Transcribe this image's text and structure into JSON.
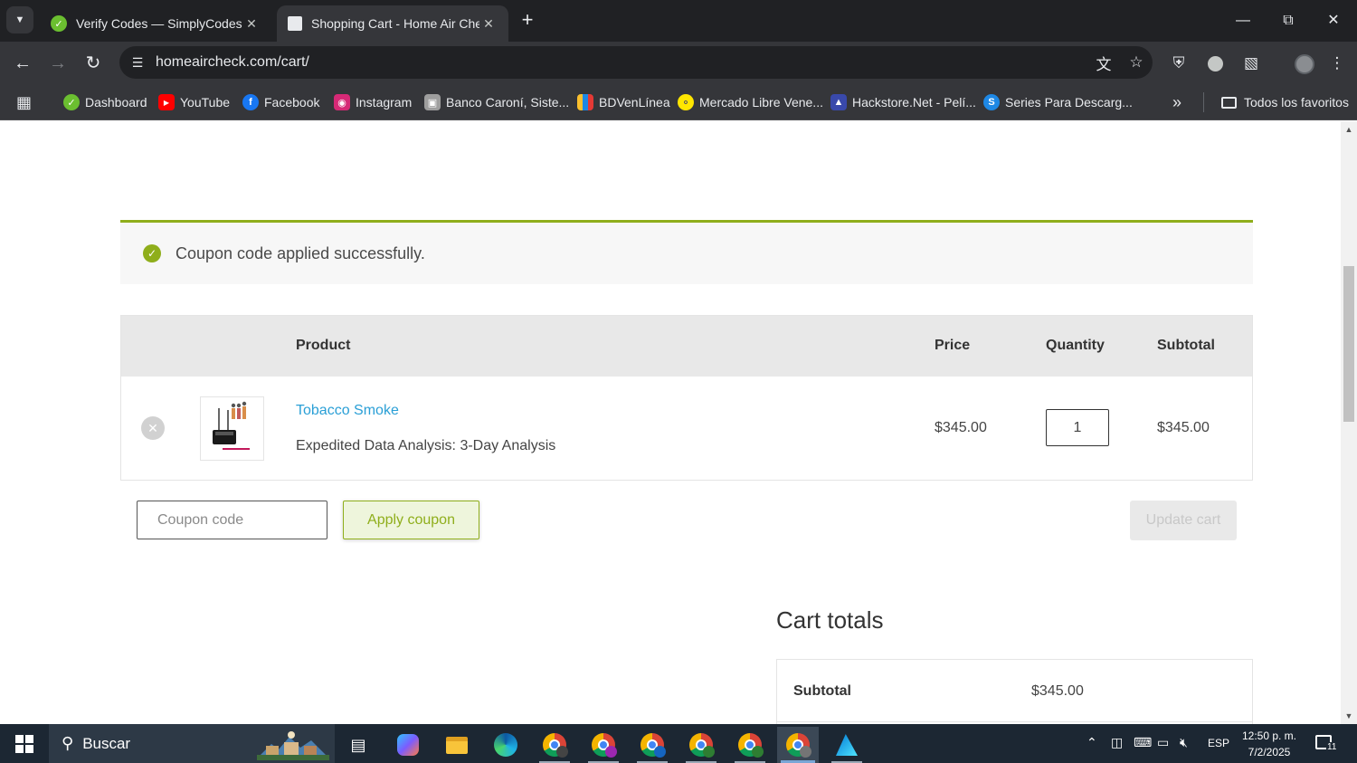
{
  "browser": {
    "tabs": [
      {
        "title": "Verify Codes — SimplyCodes",
        "active": false
      },
      {
        "title": "Shopping Cart - Home Air Chec",
        "active": true
      }
    ],
    "url": "homeaircheck.com/cart/",
    "bookmarks": [
      {
        "label": "Dashboard",
        "icon": "simplycodes-icon",
        "color": "#6bbf30"
      },
      {
        "label": "YouTube",
        "icon": "youtube-icon",
        "color": "#ff0000"
      },
      {
        "label": "Facebook",
        "icon": "facebook-icon",
        "color": "#1877f2"
      },
      {
        "label": "Instagram",
        "icon": "instagram-icon",
        "color": "#d62976"
      },
      {
        "label": "Banco Caroní, Siste...",
        "icon": "bank-icon",
        "color": "#9e9e9e"
      },
      {
        "label": "BDVenLínea",
        "icon": "bdv-icon",
        "color": "#e53935"
      },
      {
        "label": "Mercado Libre Vene...",
        "icon": "mercadolibre-icon",
        "color": "#ffe600"
      },
      {
        "label": "Hackstore.Net - Pelí...",
        "icon": "hackstore-icon",
        "color": "#3949ab"
      },
      {
        "label": "Series Para Descarg...",
        "icon": "series-icon",
        "color": "#1e88e5"
      }
    ],
    "all_bookmarks_label": "Todos los favoritos"
  },
  "notice": {
    "message": "Coupon code applied successfully.",
    "color": "#8fae1b"
  },
  "cart": {
    "headers": {
      "product": "Product",
      "price": "Price",
      "quantity": "Quantity",
      "subtotal": "Subtotal"
    },
    "items": [
      {
        "name": "Tobacco Smoke",
        "meta": "Expedited Data Analysis: 3-Day Analysis",
        "price": "$345.00",
        "quantity": "1",
        "subtotal": "$345.00"
      }
    ],
    "coupon_placeholder": "Coupon code",
    "apply_label": "Apply coupon",
    "update_label": "Update cart"
  },
  "totals": {
    "title": "Cart totals",
    "subtotal_label": "Subtotal",
    "subtotal_value": "$345.00"
  },
  "taskbar": {
    "search_placeholder": "Buscar",
    "language": "ESP",
    "time": "12:50 p. m.",
    "date": "7/2/2025",
    "notification_count": "11"
  }
}
